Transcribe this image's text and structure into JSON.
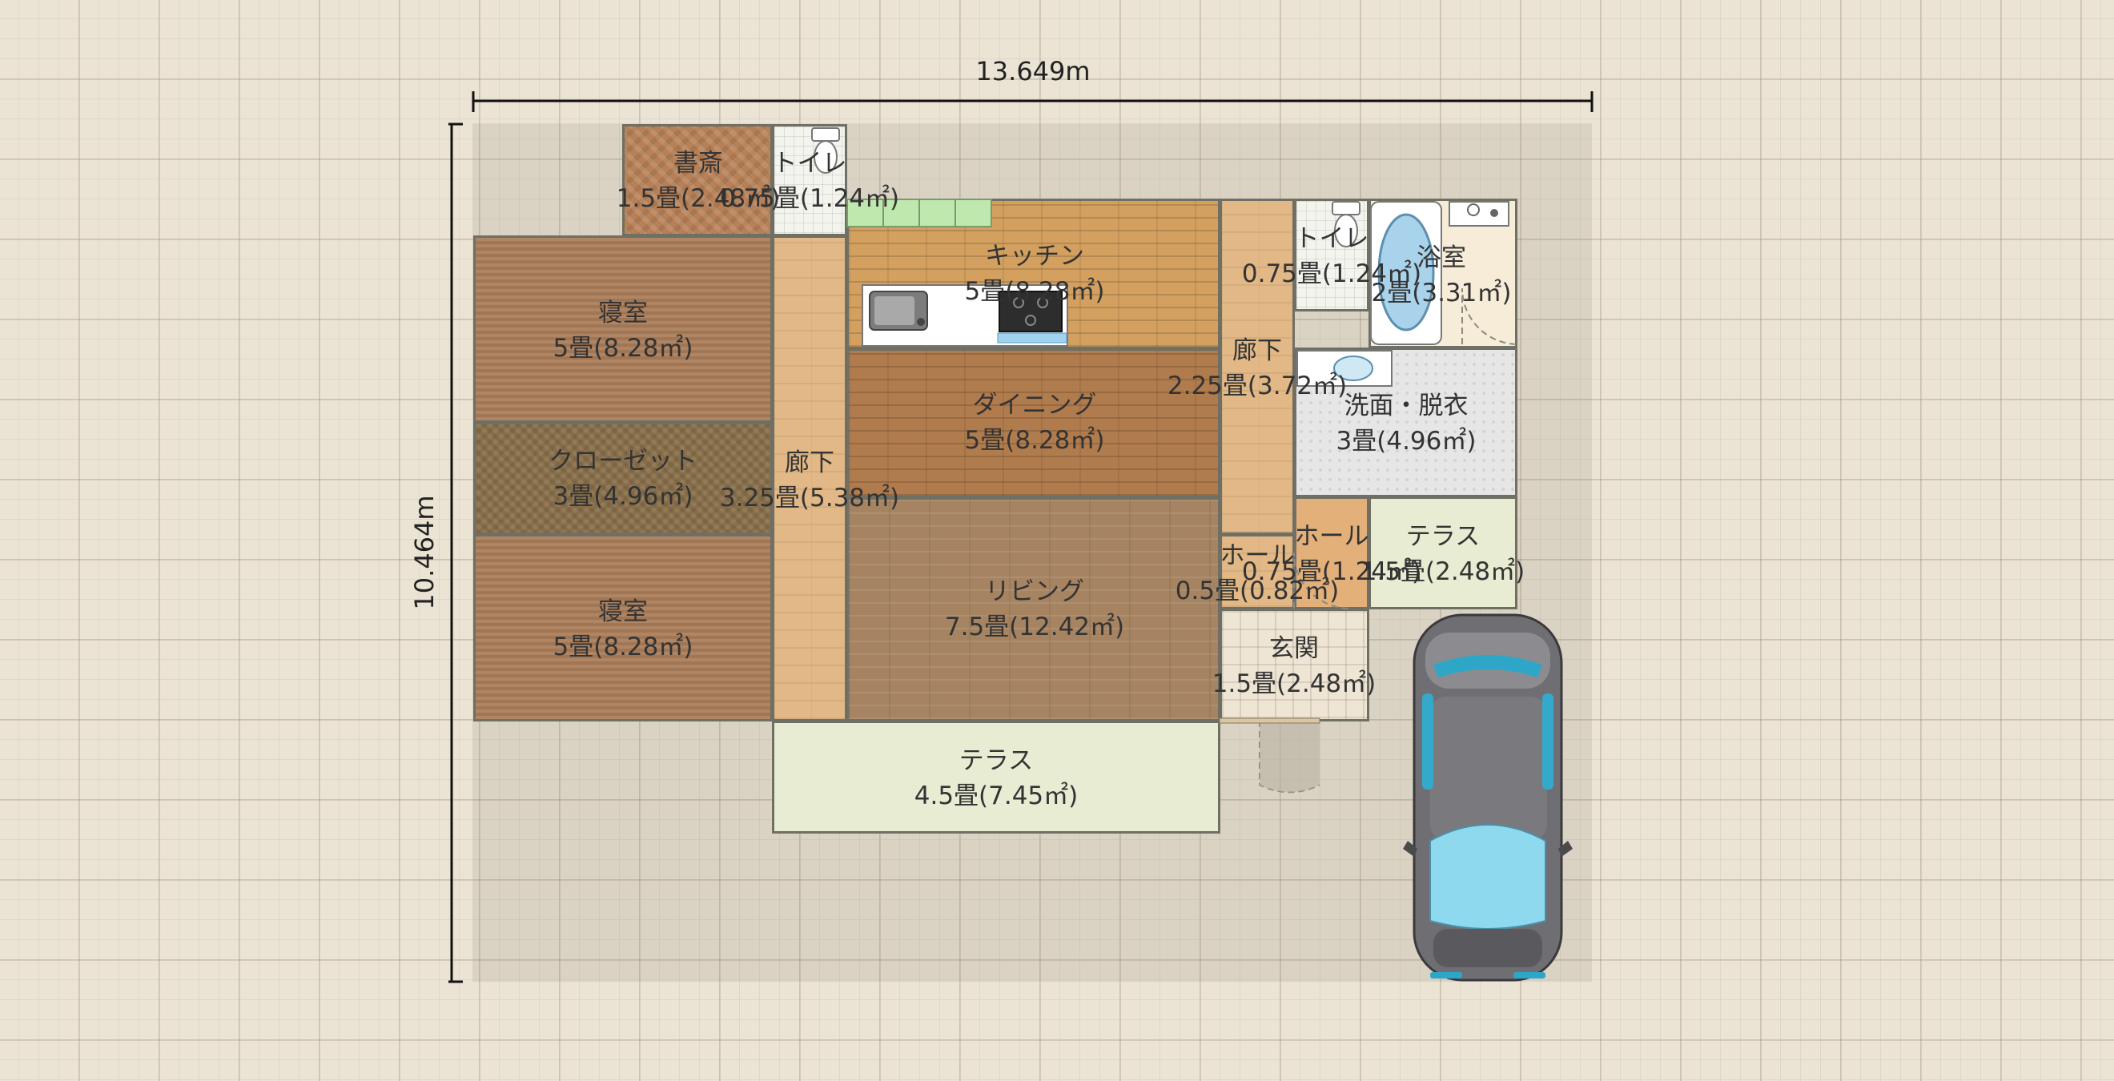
{
  "dimensions": {
    "width": "13.649m",
    "height": "10.464m"
  },
  "rooms": {
    "study": {
      "name": "書斎",
      "area": "1.5畳(2.48㎡)"
    },
    "toilet1": {
      "name": "トイレ",
      "area": "0.75畳(1.24㎡)"
    },
    "kitchen": {
      "name": "キッチン",
      "area": "5畳(8.28㎡)"
    },
    "bedroom1": {
      "name": "寝室",
      "area": "5畳(8.28㎡)"
    },
    "closet": {
      "name": "クローゼット",
      "area": "3畳(4.96㎡)"
    },
    "bedroom2": {
      "name": "寝室",
      "area": "5畳(8.28㎡)"
    },
    "corridor1": {
      "name": "廊下",
      "area": "3.25畳(5.38㎡)"
    },
    "dining": {
      "name": "ダイニング",
      "area": "5畳(8.28㎡)"
    },
    "living": {
      "name": "リビング",
      "area": "7.5畳(12.42㎡)"
    },
    "corridor2": {
      "name": "廊下",
      "area": "2.25畳(3.72㎡)"
    },
    "toilet2": {
      "name": "トイレ",
      "area": "0.75畳(1.24㎡)"
    },
    "bath": {
      "name": "浴室",
      "area": "2畳(3.31㎡)"
    },
    "washroom": {
      "name": "洗面・脱衣",
      "area": "3畳(4.96㎡)"
    },
    "hall1": {
      "name": "ホール",
      "area": "0.5畳(0.82㎡)"
    },
    "hall2": {
      "name": "ホール",
      "area": "0.75畳(1.24㎡)"
    },
    "terrace_small": {
      "name": "テラス",
      "area": "1.5畳(2.48㎡)"
    },
    "entrance": {
      "name": "玄関",
      "area": "1.5畳(2.48㎡)"
    },
    "terrace_big": {
      "name": "テラス",
      "area": "4.5畳(7.45㎡)"
    }
  },
  "icons": [
    "toilet-icon",
    "sink-icon",
    "stove-icon",
    "bathtub-icon",
    "washbasin-icon",
    "car-icon",
    "door-swing-icon"
  ],
  "colors": {
    "wall": "#6f6f64",
    "terrace": "#e8ecd3",
    "background": "#ebe3d4"
  }
}
